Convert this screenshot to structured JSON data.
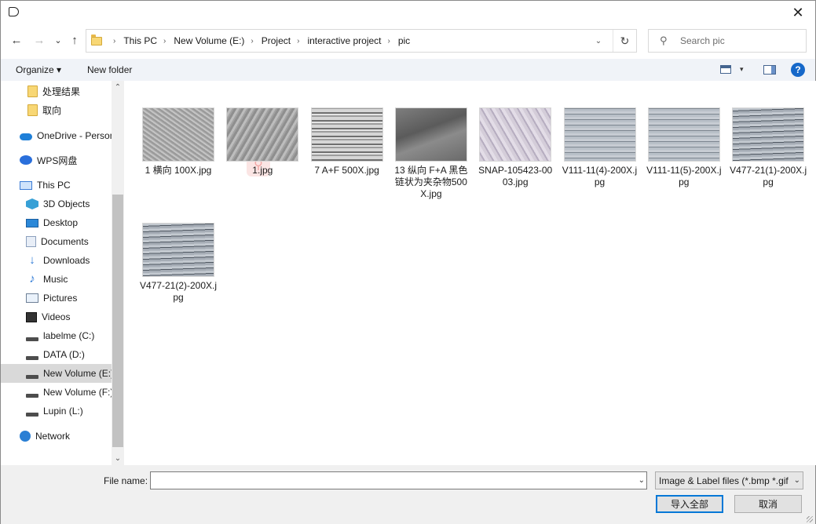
{
  "window": {
    "close_symbol": "✕"
  },
  "nav": {
    "back_symbol": "←",
    "forward_symbol": "→",
    "recent_symbol": "⌄",
    "up_symbol": "↑"
  },
  "address": {
    "crumbs": [
      "This PC",
      "New Volume (E:)",
      "Project",
      "interactive project",
      "pic"
    ],
    "sep_symbol": "›",
    "dropdown_symbol": "⌄",
    "refresh_symbol": "↻"
  },
  "search": {
    "placeholder": "Search pic",
    "icon_symbol": "⚲"
  },
  "toolbar": {
    "organize_label": "Organize ▾",
    "new_folder_label": "New folder",
    "view_dd_symbol": "▾",
    "help_symbol": "?"
  },
  "sidebar": {
    "items": [
      {
        "label": "处理结果",
        "icon": "folder-icon"
      },
      {
        "label": "取向",
        "icon": "folder-icon"
      },
      {
        "label": "OneDrive - Person",
        "icon": "cloud-icon"
      },
      {
        "label": "WPS网盘",
        "icon": "wps-cloud-icon"
      },
      {
        "label": "This PC",
        "icon": "computer-icon"
      },
      {
        "label": "3D Objects",
        "icon": "cube-icon"
      },
      {
        "label": "Desktop",
        "icon": "desktop-icon"
      },
      {
        "label": "Documents",
        "icon": "documents-icon"
      },
      {
        "label": "Downloads",
        "icon": "download-icon"
      },
      {
        "label": "Music",
        "icon": "music-icon"
      },
      {
        "label": "Pictures",
        "icon": "pictures-icon"
      },
      {
        "label": "Videos",
        "icon": "videos-icon"
      },
      {
        "label": "labelme (C:)",
        "icon": "drive-icon"
      },
      {
        "label": "DATA (D:)",
        "icon": "drive-icon"
      },
      {
        "label": "New Volume (E:)",
        "icon": "drive-icon",
        "selected": true
      },
      {
        "label": "New Volume (F:)",
        "icon": "drive-icon"
      },
      {
        "label": "Lupin (L:)",
        "icon": "drive-icon"
      },
      {
        "label": "Network",
        "icon": "network-icon"
      }
    ],
    "scroll_up": "⌃",
    "scroll_down": "⌄"
  },
  "files": [
    {
      "name": "1  横向   100X.jpg",
      "thumb": "t-grain"
    },
    {
      "name": "1.jpg",
      "thumb": "t-grain2"
    },
    {
      "name": "7  A+F  500X.jpg",
      "thumb": "t-band"
    },
    {
      "name": "13  纵向 F+A   黑色链状为夹杂物500X.jpg",
      "thumb": "t-dark"
    },
    {
      "name": "SNAP-105423-0003.jpg",
      "thumb": "t-light"
    },
    {
      "name": "V111-11(4)-200X.jpg",
      "thumb": "t-dots"
    },
    {
      "name": "V111-11(5)-200X.jpg",
      "thumb": "t-dots"
    },
    {
      "name": "V477-21(1)-200X.jpg",
      "thumb": "t-stripe"
    },
    {
      "name": "V477-21(2)-200X.jpg",
      "thumb": "t-stripe"
    }
  ],
  "bottom": {
    "file_name_label": "File name:",
    "file_name_value": "",
    "file_name_dd": "⌄",
    "filter_label": "Image & Label files (*.bmp *.gif",
    "filter_dd": "⌄",
    "open_label": "导入全部",
    "cancel_label": "取消"
  }
}
